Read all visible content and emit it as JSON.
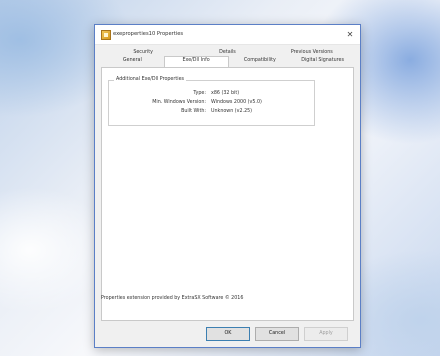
{
  "window": {
    "title": "exeproperties10 Properties",
    "close_symbol": "✕"
  },
  "tabs": {
    "back_row": [
      "Security",
      "Details",
      "Previous Versions"
    ],
    "front_row": [
      "General",
      "Exe/Dll Info",
      "Compatibility",
      "Digital Signatures"
    ],
    "selected": "Exe/Dll Info"
  },
  "group": {
    "label": "Additional Exe/Dll Properties",
    "rows": [
      {
        "label": "Type:",
        "value": "x86 (32 bit)"
      },
      {
        "label": "Min. Windows Version:",
        "value": "Windows 2000 (v5.0)"
      },
      {
        "label": "Built With:",
        "value": "Unknown (v2.25)"
      }
    ]
  },
  "footer": {
    "text": "Properties extension provided by ExtraSX Software © 2016"
  },
  "buttons": {
    "ok": "OK",
    "cancel": "Cancel",
    "apply": "Apply"
  },
  "icons": {
    "app": "exe-file-icon",
    "close": "close-icon"
  },
  "colors": {
    "window_border": "#5b7fc6",
    "dialog_bg": "#f0f0f0",
    "panel_bg": "#ffffff"
  }
}
